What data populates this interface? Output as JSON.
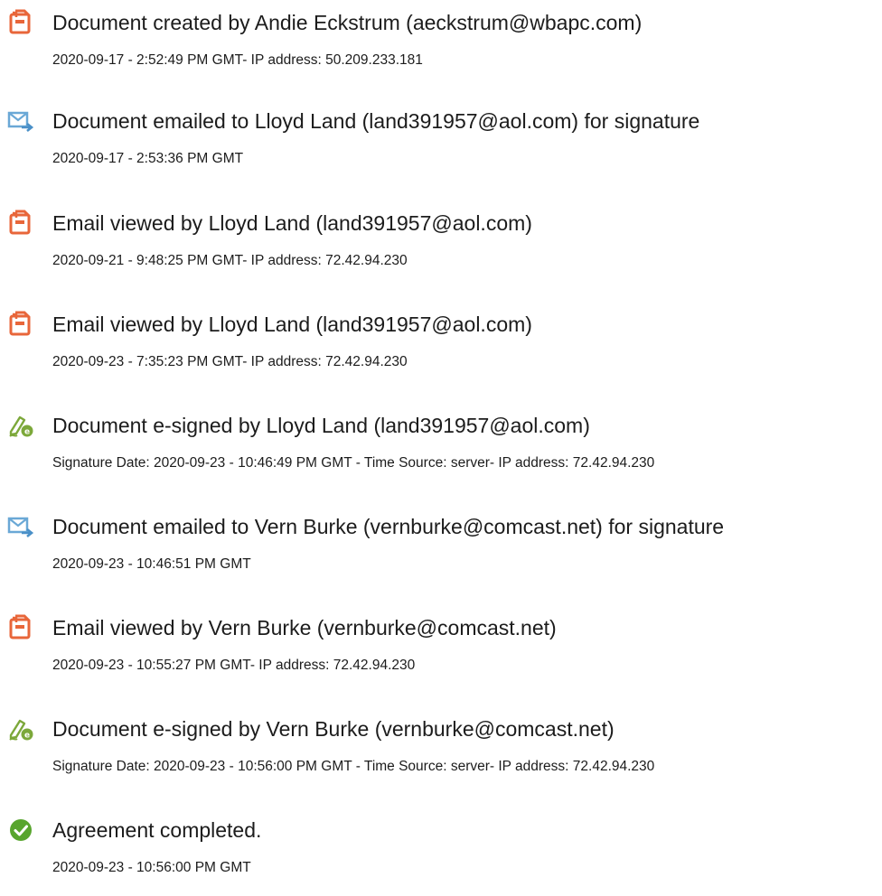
{
  "colors": {
    "pdf_icon": "#e8663a",
    "email_icon": "#6aa8d6",
    "sign_icon": "#7ca83a",
    "complete_icon": "#58a52e"
  },
  "entries": [
    {
      "icon": "document-icon",
      "title": "Document created by Andie Eckstrum (aeckstrum@wbapc.com)",
      "detail": "2020-09-17 - 2:52:49 PM GMT- IP address: 50.209.233.181"
    },
    {
      "icon": "email-sent-icon",
      "title": "Document emailed to Lloyd Land (land391957@aol.com) for signature",
      "detail": "2020-09-17 - 2:53:36 PM GMT"
    },
    {
      "icon": "document-icon",
      "title": "Email viewed by Lloyd Land (land391957@aol.com)",
      "detail": "2020-09-21 - 9:48:25 PM GMT- IP address: 72.42.94.230"
    },
    {
      "icon": "document-icon",
      "title": "Email viewed by Lloyd Land (land391957@aol.com)",
      "detail": "2020-09-23 - 7:35:23 PM GMT- IP address: 72.42.94.230"
    },
    {
      "icon": "e-sign-pen-icon",
      "title": "Document e-signed by Lloyd Land (land391957@aol.com)",
      "detail": "Signature Date: 2020-09-23 - 10:46:49 PM GMT - Time Source: server- IP address: 72.42.94.230"
    },
    {
      "icon": "email-sent-icon",
      "title": "Document emailed to Vern Burke (vernburke@comcast.net) for signature",
      "detail": "2020-09-23 - 10:46:51 PM GMT"
    },
    {
      "icon": "document-icon",
      "title": "Email viewed by Vern Burke (vernburke@comcast.net)",
      "detail": "2020-09-23 - 10:55:27 PM GMT- IP address: 72.42.94.230"
    },
    {
      "icon": "e-sign-pen-icon",
      "title": "Document e-signed by Vern Burke (vernburke@comcast.net)",
      "detail": "Signature Date: 2020-09-23 - 10:56:00 PM GMT - Time Source: server- IP address: 72.42.94.230"
    },
    {
      "icon": "checkmark-circle-icon",
      "title": "Agreement completed.",
      "detail": "2020-09-23 - 10:56:00 PM GMT"
    }
  ]
}
